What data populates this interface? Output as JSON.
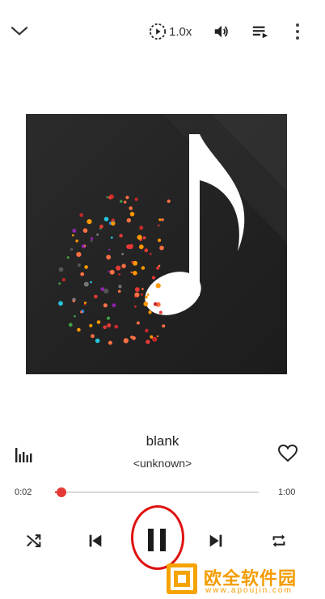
{
  "topbar": {
    "collapse_icon": "chevron-down-icon",
    "speed_label": "1.0x",
    "speed_icon": "playback-speed-icon",
    "volume_icon": "volume-icon",
    "queue_icon": "playlist-queue-icon",
    "more_icon": "more-vert-icon"
  },
  "track": {
    "title": "blank",
    "artist": "<unknown>"
  },
  "progress": {
    "elapsed": "0:02",
    "duration": "1:00",
    "fraction": 0.033
  },
  "controls": {
    "shuffle_icon": "shuffle-icon",
    "previous_icon": "skip-previous-icon",
    "play_pause_icon": "pause-icon",
    "next_icon": "skip-next-icon",
    "repeat_icon": "repeat-icon"
  },
  "watermark": {
    "text": "欧全软件园",
    "url": "www.apoujin.com"
  },
  "colors": {
    "accent": "#e53935",
    "annotation": "#e01010",
    "watermark": "#f39c00"
  }
}
